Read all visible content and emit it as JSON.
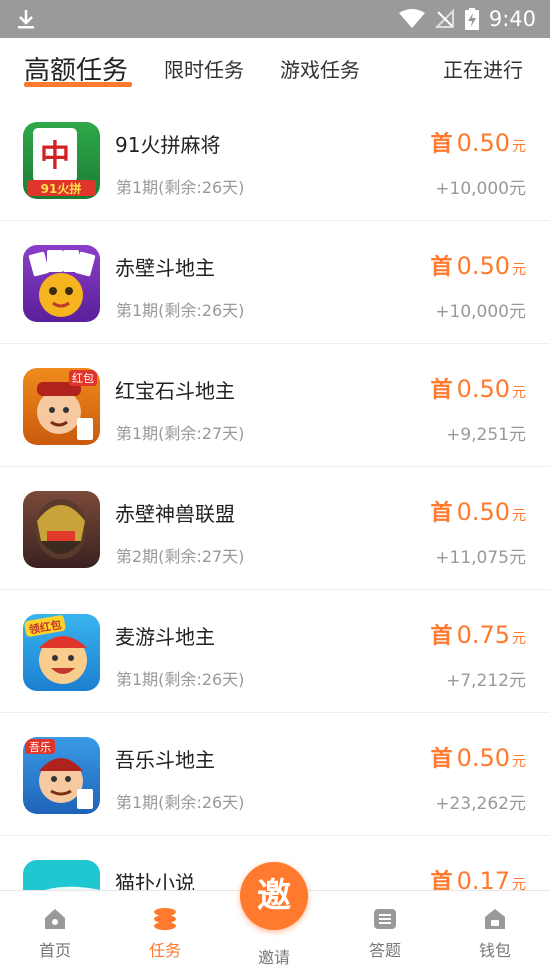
{
  "status_bar": {
    "time": "9:40"
  },
  "tabs": [
    {
      "label": "高额任务",
      "active": true
    },
    {
      "label": "限时任务",
      "active": false
    },
    {
      "label": "游戏任务",
      "active": false
    },
    {
      "label": "正在进行",
      "active": false
    }
  ],
  "tasks": [
    {
      "name": "91火拼麻将",
      "period": "第1期(剩余:26天)",
      "first_badge": "首",
      "amount": "0.50",
      "unit": "元",
      "total": "+10,000元",
      "icon_label": "中",
      "icon_sub": "91火拼"
    },
    {
      "name": "赤壁斗地主",
      "period": "第1期(剩余:26天)",
      "first_badge": "首",
      "amount": "0.50",
      "unit": "元",
      "total": "+10,000元",
      "icon_label": "",
      "icon_sub": ""
    },
    {
      "name": "红宝石斗地主",
      "period": "第1期(剩余:27天)",
      "first_badge": "首",
      "amount": "0.50",
      "unit": "元",
      "total": "+9,251元",
      "icon_label": "红包",
      "icon_sub": ""
    },
    {
      "name": "赤壁神兽联盟",
      "period": "第2期(剩余:27天)",
      "first_badge": "首",
      "amount": "0.50",
      "unit": "元",
      "total": "+11,075元",
      "icon_label": "",
      "icon_sub": ""
    },
    {
      "name": "麦游斗地主",
      "period": "第1期(剩余:26天)",
      "first_badge": "首",
      "amount": "0.75",
      "unit": "元",
      "total": "+7,212元",
      "icon_label": "领红包",
      "icon_sub": ""
    },
    {
      "name": "吾乐斗地主",
      "period": "第1期(剩余:26天)",
      "first_badge": "首",
      "amount": "0.50",
      "unit": "元",
      "total": "+23,262元",
      "icon_label": "吾乐",
      "icon_sub": ""
    },
    {
      "name": "猫扑小说",
      "period": "",
      "first_badge": "首",
      "amount": "0.17",
      "unit": "元",
      "total": "",
      "icon_label": "",
      "icon_sub": ""
    }
  ],
  "bottom_nav": [
    {
      "label": "首页",
      "icon": "home-icon",
      "active": false
    },
    {
      "label": "任务",
      "icon": "coins-icon",
      "active": true
    },
    {
      "label": "邀请",
      "icon": "invite-icon",
      "active": false
    },
    {
      "label": "答题",
      "icon": "list-icon",
      "active": false
    },
    {
      "label": "钱包",
      "icon": "wallet-icon",
      "active": false
    }
  ],
  "invite_button": {
    "glyph": "邀"
  },
  "colors": {
    "accent": "#ff7a2f",
    "statusbar": "#9a9a9a"
  }
}
